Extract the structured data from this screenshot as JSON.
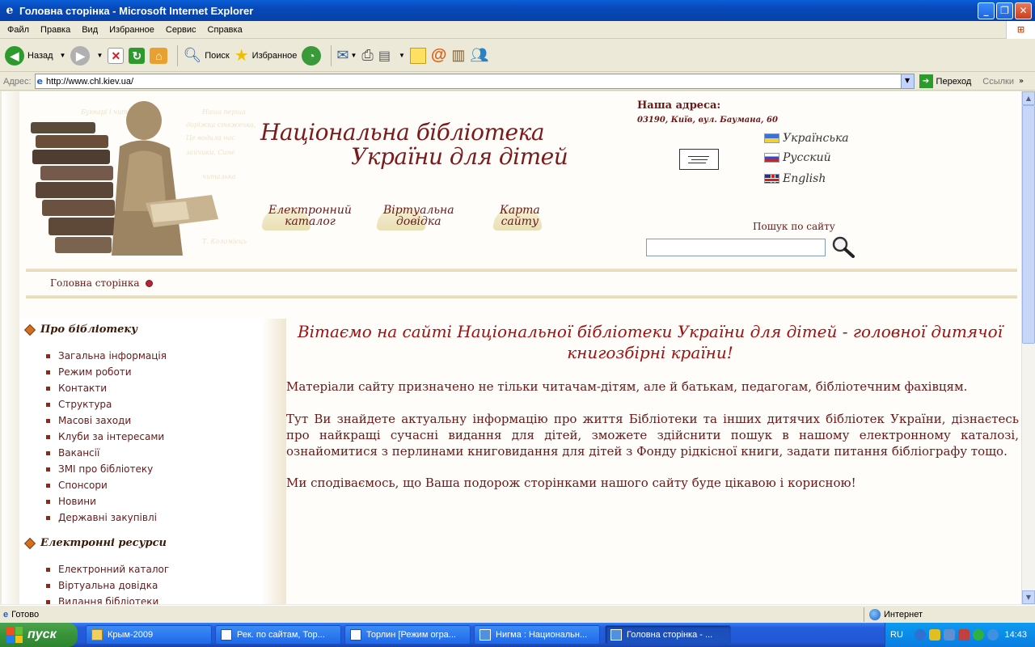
{
  "window": {
    "title": "Головна сторінка - Microsoft Internet Explorer"
  },
  "menu": [
    "Файл",
    "Правка",
    "Вид",
    "Избранное",
    "Сервис",
    "Справка"
  ],
  "toolbar": {
    "back": "Назад",
    "search": "Поиск",
    "favorites": "Избранное"
  },
  "address": {
    "label": "Адрес:",
    "url": "http://www.chl.kiev.ua/",
    "go": "Переход",
    "links": "Ссылки"
  },
  "page": {
    "title_line1": "Національна бібліотека",
    "title_line2": "України для дітей",
    "nav": [
      {
        "l1": "Електронний",
        "l2": "каталог"
      },
      {
        "l1": "Віртуальна",
        "l2": "довідка"
      },
      {
        "l1": "Карта",
        "l2": "сайту"
      }
    ],
    "address_heading": "Наша адреса:",
    "address_text": "03190, Київ, вул. Баумана, 60",
    "languages": [
      "Українська",
      "Русский",
      "English"
    ],
    "search_label": "Пошук по сайту",
    "breadcrumb": "Головна сторінка",
    "sidebar": {
      "section1": "Про бібліотеку",
      "section1_items": [
        "Загальна інформація",
        "Режим роботи",
        "Контакти",
        "Структура",
        "Масові заходи",
        "Клуби за інтересами",
        "Вакансії",
        "ЗМІ про бібліотеку",
        "Спонсори",
        "Новини",
        "Державні закупівлі"
      ],
      "section2": "Електронні ресурси",
      "section2_items": [
        "Електронний каталог",
        "Віртуальна довідка",
        "Видання бібліотеки"
      ]
    },
    "welcome": "Вітаємо на сайті Національної бібліотеки України для дітей - головної дитячої книгозбірні країни!",
    "para1": "Матеріали сайту призначено не тільки читачам-дітям, але й батькам, педагогам, бібліотечним фахівцям.",
    "para2": "Тут Ви знайдете актуальну інформацію про життя Бібліотеки та інших дитячих бібліотек України, дізнаєтесь про найкращі сучасні видання для дітей, зможете здійснити пошук в нашому електронному каталозі, ознайомитися з перлинами книговидання для дітей з Фонду рідкісної книги, задати питання бібліографу тощо.",
    "para3": "Ми сподіваємось, що Ваша подорож сторінками нашого сайту буде цікавою і корисною!"
  },
  "status": {
    "text": "Готово",
    "zone": "Интернет"
  },
  "taskbar": {
    "start": "пуск",
    "tasks": [
      "Крым-2009",
      "Рек. по сайтам, Тор...",
      "Торлин [Режим огра...",
      "Нигма : Национальн...",
      "Головна сторінка - ..."
    ],
    "lang": "RU",
    "clock": "14:43"
  }
}
